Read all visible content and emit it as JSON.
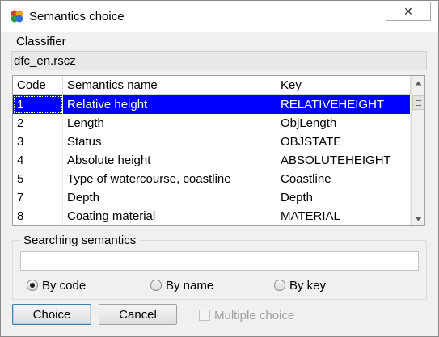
{
  "window": {
    "title": "Semantics choice",
    "close_symbol": "✕"
  },
  "classifier": {
    "label": "Classifier",
    "value": "dfc_en.rscz"
  },
  "table": {
    "columns": [
      "Code",
      "Semantics name",
      "Key"
    ],
    "rows": [
      {
        "code": "1",
        "name": "Relative height",
        "key": "RELATIVEHEIGHT",
        "selected": true
      },
      {
        "code": "2",
        "name": "Length",
        "key": "ObjLength",
        "selected": false
      },
      {
        "code": "3",
        "name": "Status",
        "key": "OBJSTATE",
        "selected": false
      },
      {
        "code": "4",
        "name": "Absolute height",
        "key": "ABSOLUTEHEIGHT",
        "selected": false
      },
      {
        "code": "5",
        "name": "Type of watercourse, coastline",
        "key": "Coastline",
        "selected": false
      },
      {
        "code": "7",
        "name": "Depth",
        "key": "Depth",
        "selected": false
      },
      {
        "code": "8",
        "name": "Coating material",
        "key": "MATERIAL",
        "selected": false
      }
    ]
  },
  "search": {
    "legend": "Searching semantics",
    "value": "",
    "options": [
      {
        "label": "By code",
        "checked": true
      },
      {
        "label": "By name",
        "checked": false
      },
      {
        "label": "By key",
        "checked": false
      }
    ]
  },
  "buttons": {
    "choice": "Choice",
    "cancel": "Cancel"
  },
  "multiple_choice": {
    "label": "Multiple choice",
    "checked": false,
    "enabled": false
  },
  "colors": {
    "selection": "#0000ff",
    "selection_text": "#ffffff",
    "dialog_bg": "#f0f0f0",
    "disabled_text": "#a0a0a0"
  }
}
